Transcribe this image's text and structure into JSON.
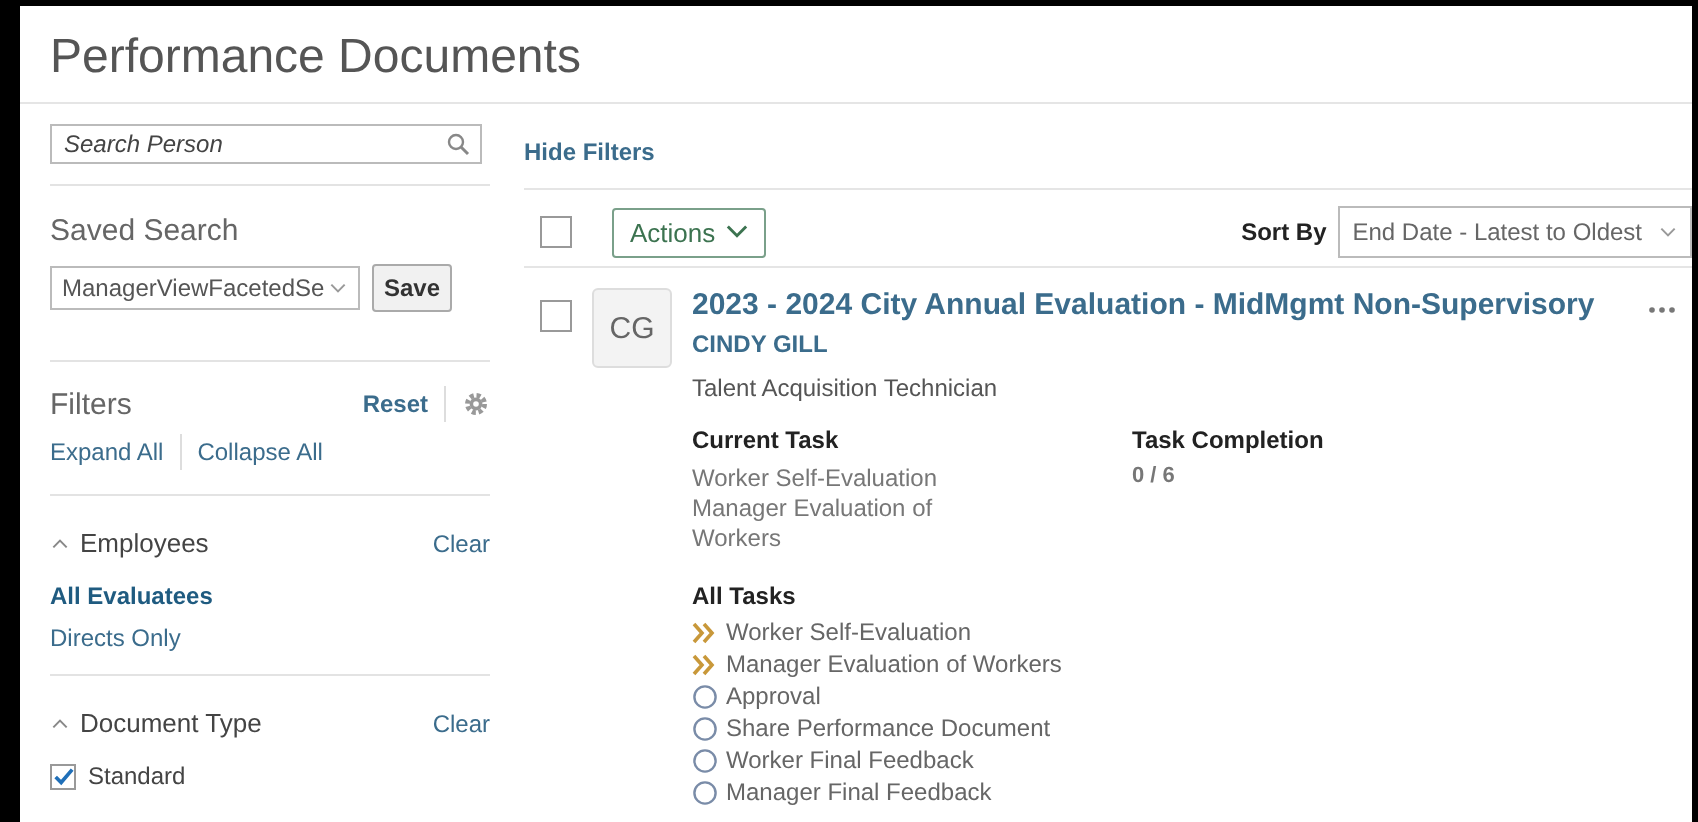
{
  "page_title": "Performance Documents",
  "search": {
    "placeholder": "Search Person"
  },
  "saved_search": {
    "label": "Saved Search",
    "value": "ManagerViewFacetedSe",
    "button": "Save"
  },
  "filters": {
    "title": "Filters",
    "reset": "Reset",
    "expand_all": "Expand All",
    "collapse_all": "Collapse All",
    "groups": [
      {
        "title": "Employees",
        "clear": "Clear",
        "expanded": true,
        "kind": "options",
        "options": [
          {
            "label": "All Evaluatees",
            "selected": true
          },
          {
            "label": "Directs Only",
            "selected": false
          }
        ]
      },
      {
        "title": "Document Type",
        "clear": "Clear",
        "expanded": true,
        "kind": "checkboxes",
        "options": [
          {
            "label": "Standard",
            "checked": true
          }
        ]
      }
    ]
  },
  "hide_filters": "Hide Filters",
  "toolbar": {
    "select_all_checked": false,
    "actions": "Actions",
    "sort_label": "Sort By",
    "sort_value": "End Date - Latest to Oldest"
  },
  "documents": [
    {
      "checked": false,
      "initials": "CG",
      "title": "2023 - 2024 City Annual Evaluation - MidMgmt Non-Supervisory",
      "name": "CINDY GILL",
      "job": "Talent Acquisition Technician",
      "current_task_label": "Current Task",
      "current_tasks": [
        "Worker Self-Evaluation",
        "Manager Evaluation of Workers"
      ],
      "completion_label": "Task Completion",
      "completion": "0 / 6",
      "all_tasks_label": "All Tasks",
      "tasks": [
        {
          "label": "Worker Self-Evaluation",
          "kind": "in_progress"
        },
        {
          "label": "Manager Evaluation of Workers",
          "kind": "in_progress"
        },
        {
          "label": "Approval",
          "kind": "not_started"
        },
        {
          "label": "Share Performance Document",
          "kind": "not_started"
        },
        {
          "label": "Worker Final Feedback",
          "kind": "not_started"
        },
        {
          "label": "Manager Final Feedback",
          "kind": "not_started"
        }
      ]
    }
  ]
}
